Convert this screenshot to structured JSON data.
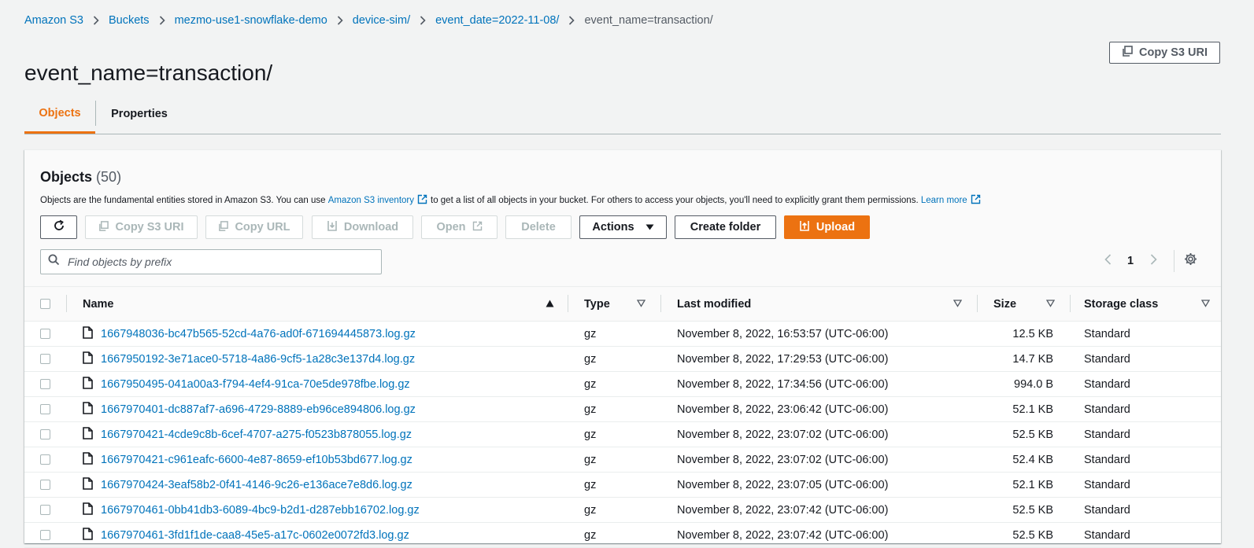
{
  "breadcrumb": {
    "items": [
      "Amazon S3",
      "Buckets",
      "mezmo-use1-snowflake-demo",
      "device-sim/",
      "event_date=2022-11-08/"
    ],
    "current": "event_name=transaction/"
  },
  "page": {
    "title": "event_name=transaction/",
    "copy_uri_label": "Copy S3 URI"
  },
  "tabs": [
    {
      "label": "Objects",
      "active": true
    },
    {
      "label": "Properties",
      "active": false
    }
  ],
  "objects_panel": {
    "title": "Objects",
    "count": "(50)",
    "desc_part1": "Objects are the fundamental entities stored in Amazon S3. You can use",
    "desc_link1": "Amazon S3 inventory",
    "desc_part2": "to get a list of all objects in your bucket. For others to access your objects, you'll need to explicitly grant them permissions.",
    "desc_link2": "Learn more"
  },
  "toolbar": {
    "copy_s3_uri": "Copy S3 URI",
    "copy_url": "Copy URL",
    "download": "Download",
    "open": "Open",
    "delete": "Delete",
    "actions": "Actions",
    "create_folder": "Create folder",
    "upload": "Upload"
  },
  "search": {
    "placeholder": "Find objects by prefix",
    "value": ""
  },
  "pagination": {
    "current_page": "1"
  },
  "table": {
    "columns": [
      "Name",
      "Type",
      "Last modified",
      "Size",
      "Storage class"
    ],
    "rows": [
      {
        "name": "1667948036-bc47b565-52cd-4a76-ad0f-671694445873.log.gz",
        "type": "gz",
        "modified": "November 8, 2022, 16:53:57 (UTC-06:00)",
        "size": "12.5 KB",
        "storage": "Standard"
      },
      {
        "name": "1667950192-3e71ace0-5718-4a86-9cf5-1a28c3e137d4.log.gz",
        "type": "gz",
        "modified": "November 8, 2022, 17:29:53 (UTC-06:00)",
        "size": "14.7 KB",
        "storage": "Standard"
      },
      {
        "name": "1667950495-041a00a3-f794-4ef4-91ca-70e5de978fbe.log.gz",
        "type": "gz",
        "modified": "November 8, 2022, 17:34:56 (UTC-06:00)",
        "size": "994.0 B",
        "storage": "Standard"
      },
      {
        "name": "1667970401-dc887af7-a696-4729-8889-eb96ce894806.log.gz",
        "type": "gz",
        "modified": "November 8, 2022, 23:06:42 (UTC-06:00)",
        "size": "52.1 KB",
        "storage": "Standard"
      },
      {
        "name": "1667970421-4cde9c8b-6cef-4707-a275-f0523b878055.log.gz",
        "type": "gz",
        "modified": "November 8, 2022, 23:07:02 (UTC-06:00)",
        "size": "52.5 KB",
        "storage": "Standard"
      },
      {
        "name": "1667970421-c961eafc-6600-4e87-8659-ef10b53bd677.log.gz",
        "type": "gz",
        "modified": "November 8, 2022, 23:07:02 (UTC-06:00)",
        "size": "52.4 KB",
        "storage": "Standard"
      },
      {
        "name": "1667970424-3eaf58b2-0f41-4146-9c26-e136ace7e8d6.log.gz",
        "type": "gz",
        "modified": "November 8, 2022, 23:07:05 (UTC-06:00)",
        "size": "52.1 KB",
        "storage": "Standard"
      },
      {
        "name": "1667970461-0bb41db3-6089-4bc9-b2d1-d287ebb16702.log.gz",
        "type": "gz",
        "modified": "November 8, 2022, 23:07:42 (UTC-06:00)",
        "size": "52.5 KB",
        "storage": "Standard"
      },
      {
        "name": "1667970461-3fd1f1de-caa8-45e5-a17c-0602e0072fd3.log.gz",
        "type": "gz",
        "modified": "November 8, 2022, 23:07:42 (UTC-06:00)",
        "size": "52.5 KB",
        "storage": "Standard"
      }
    ]
  },
  "colors": {
    "link": "#0073bb",
    "accent": "#ec7211",
    "text": "#16191f",
    "muted": "#545b64",
    "background": "#f2f3f3"
  }
}
